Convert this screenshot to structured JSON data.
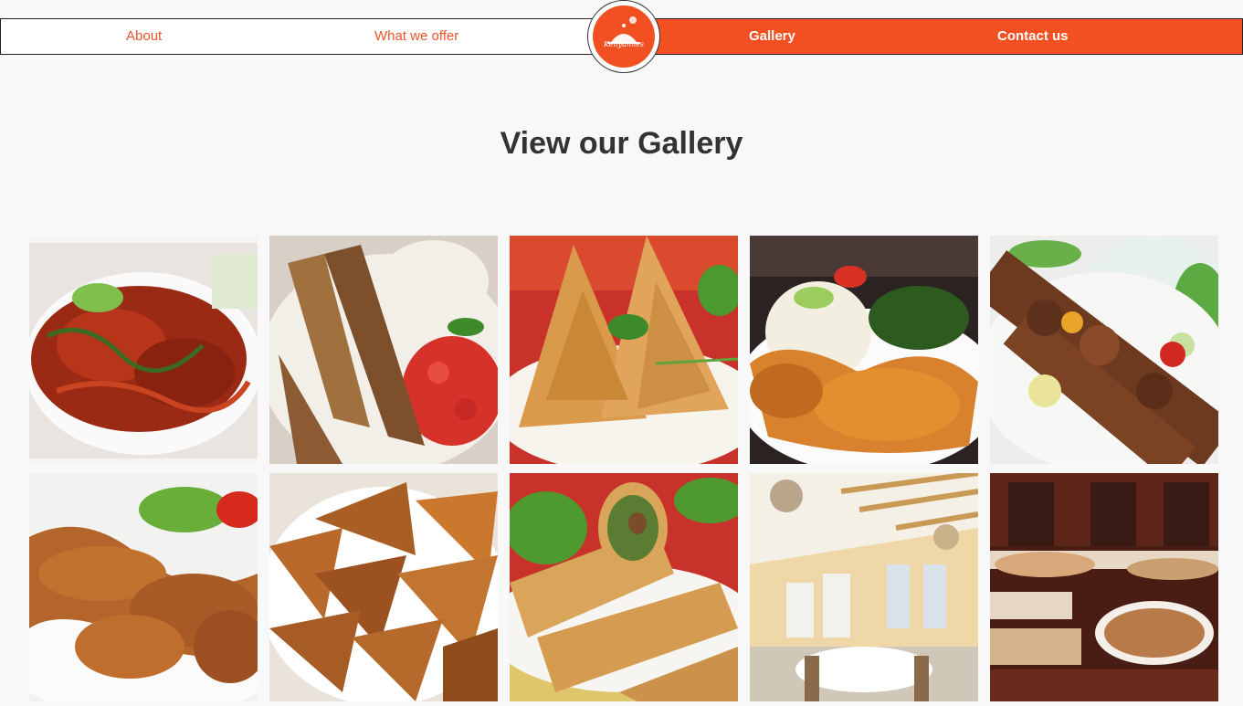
{
  "nav": {
    "about": "About",
    "offer": "What we offer",
    "gallery": "Gallery",
    "contact": "Contact us",
    "logo_text": "Kenyannes"
  },
  "colors": {
    "accent": "#f25022",
    "nav_left_text": "#e8542a",
    "background": "#f8f8f8",
    "heading": "#333333"
  },
  "gallery": {
    "title": "View our Gallery",
    "images": [
      "chili-squid-photo",
      "roast-meat-ugali-photo",
      "samosa-photo",
      "chicken-rice-plate-photo",
      "meat-skewers-photo",
      "grilled-chicken-drumsticks-photo",
      "mandazi-photo",
      "spring-rolls-photo",
      "banquet-dining-room-photo",
      "pastry-buffet-display-photo"
    ]
  }
}
